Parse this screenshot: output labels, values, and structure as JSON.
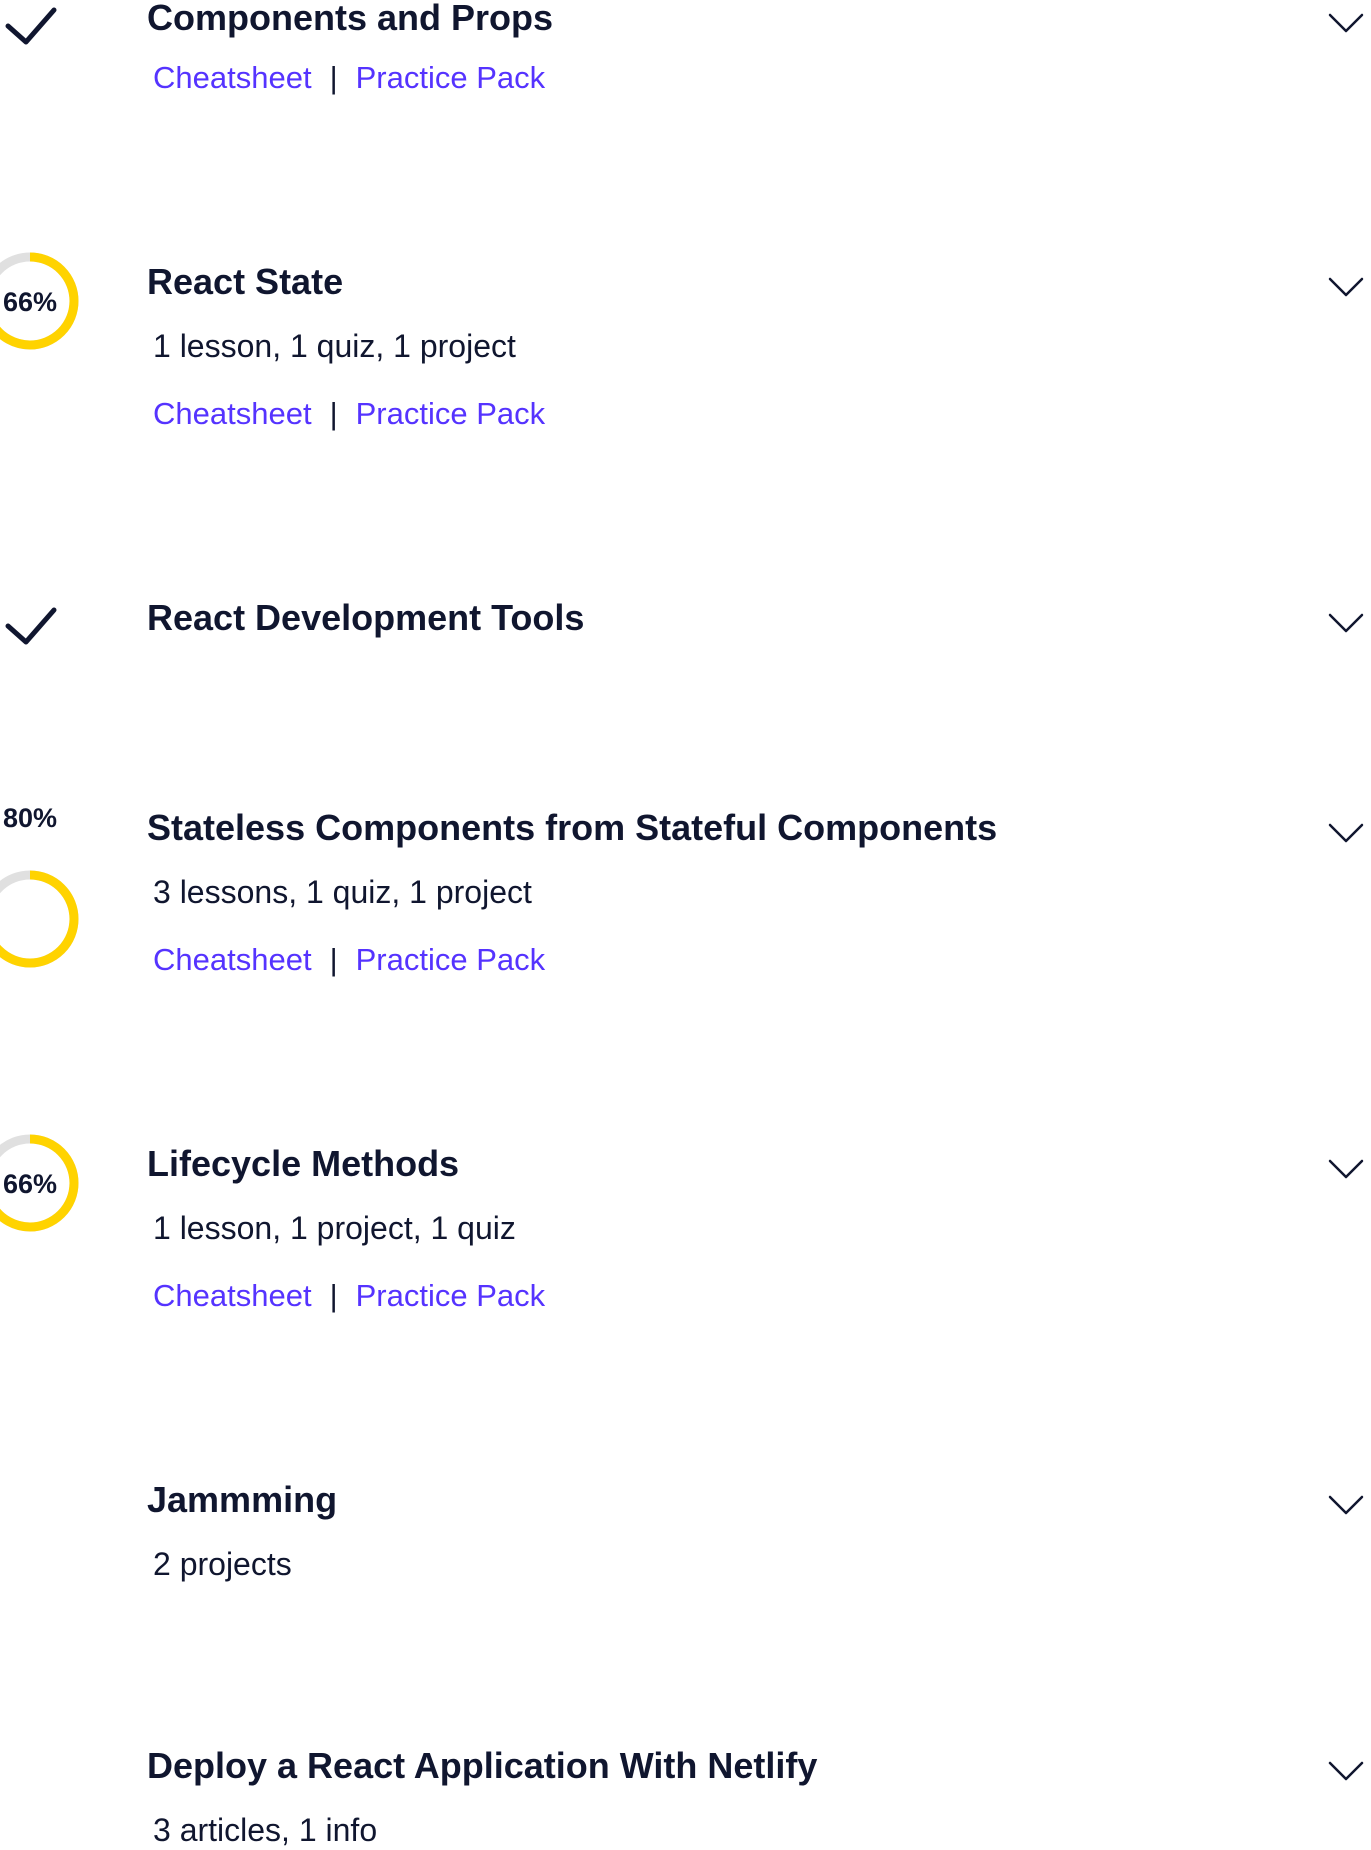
{
  "modules": [
    {
      "title": "Components and Props",
      "meta": "",
      "status": "complete",
      "icon": "checkmark-icon",
      "links": {
        "cheatsheet": "Cheatsheet",
        "separator": "|",
        "practice": "Practice Pack"
      }
    },
    {
      "title": "React State",
      "meta": "1 lesson, 1 quiz, 1 project",
      "status": "in-progress",
      "progress_label": "66%",
      "progress": 0.66,
      "links": {
        "cheatsheet": "Cheatsheet",
        "separator": "|",
        "practice": "Practice Pack"
      }
    },
    {
      "title": "React Development Tools",
      "meta": "",
      "status": "complete",
      "icon": "checkmark-icon"
    },
    {
      "title": "Stateless Components from Stateful Components",
      "meta": "3 lessons, 1 quiz, 1 project",
      "status": "in-progress",
      "progress_label": "80%",
      "progress": 0.8,
      "links": {
        "cheatsheet": "Cheatsheet",
        "separator": "|",
        "practice": "Practice Pack"
      }
    },
    {
      "title": "Lifecycle Methods",
      "meta": "1 lesson, 1 project, 1 quiz",
      "status": "in-progress",
      "progress_label": "66%",
      "progress": 0.66,
      "links": {
        "cheatsheet": "Cheatsheet",
        "separator": "|",
        "practice": "Practice Pack"
      }
    },
    {
      "title": "Jammming",
      "meta": "2 projects",
      "status": "not-started"
    },
    {
      "title": "Deploy a React Application With Netlify",
      "meta": "3 articles, 1 info",
      "status": "not-started"
    }
  ],
  "colors": {
    "text": "#10162f",
    "link": "#5533ff",
    "progress_fill": "#ffd300",
    "progress_track": "#e0e0e0"
  },
  "icons": {
    "expand": "chevron-down-icon",
    "complete": "checkmark-icon",
    "progress": "progress-ring-icon"
  }
}
